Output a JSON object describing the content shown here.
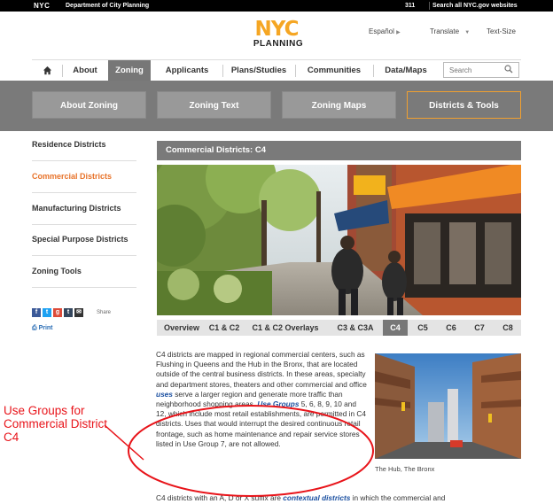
{
  "topbar": {
    "logo": "NYC",
    "dept": "Department of City Planning",
    "link_311": "311",
    "link_search_all": "Search all NYC.gov websites"
  },
  "header": {
    "logo_top": "NYC",
    "logo_bottom": "PLANNING",
    "espanol": "Español",
    "translate": "Translate",
    "text_size": "Text-Size"
  },
  "nav": {
    "items": [
      "About",
      "Zoning",
      "Applicants",
      "Plans/Studies",
      "Communities",
      "Data/Maps"
    ],
    "active": "Zoning",
    "search_placeholder": "Search"
  },
  "subnav": {
    "items": [
      "About Zoning",
      "Zoning Text",
      "Zoning Maps",
      "Districts & Tools"
    ],
    "active": "Districts & Tools"
  },
  "sidebar": {
    "items": [
      "Residence Districts",
      "Commercial Districts",
      "Manufacturing Districts",
      "Special Purpose Districts",
      "Zoning Tools"
    ],
    "active": "Commercial Districts",
    "share": "Share",
    "print": "Print"
  },
  "content": {
    "title": "Commercial Districts: C4",
    "tabs": [
      "Overview",
      "C1 & C2",
      "C1 & C2 Overlays",
      "C3 & C3A",
      "C4",
      "C5",
      "C6",
      "C7",
      "C8"
    ],
    "active_tab": "C4",
    "para_a": "C4 districts are mapped in regional commercial centers, such as Flushing in Queens and the Hub in the Bronx, that are located outside of the central business districts. In these areas, specialty and department stores, theaters and other commercial and office ",
    "link_uses": "uses",
    "para_b": " serve a larger region and generate more traffic than neighborhood shopping areas. ",
    "link_use_groups": "Use Groups",
    "para_c": " 5, 6, 8, 9, 10 and 12, which include most retail establishments, are permitted in C4 districts. Uses that would interrupt the desired continuous retail frontage, such as home maintenance and repair service stores listed in Use Group 7, are not allowed.",
    "last_a": "C4 districts with an A, D or X suffix are ",
    "last_link": "contextual districts",
    "last_b": " in which the commercial and",
    "photo_caption": "The Hub, The Bronx"
  },
  "annotation": {
    "text": "Use Groups for Commercial District C4",
    "color": "#e8141a"
  },
  "colors": {
    "accent_orange": "#e8732a",
    "link_blue": "#1a4fa0",
    "nav_gray": "#7a7a7a"
  }
}
